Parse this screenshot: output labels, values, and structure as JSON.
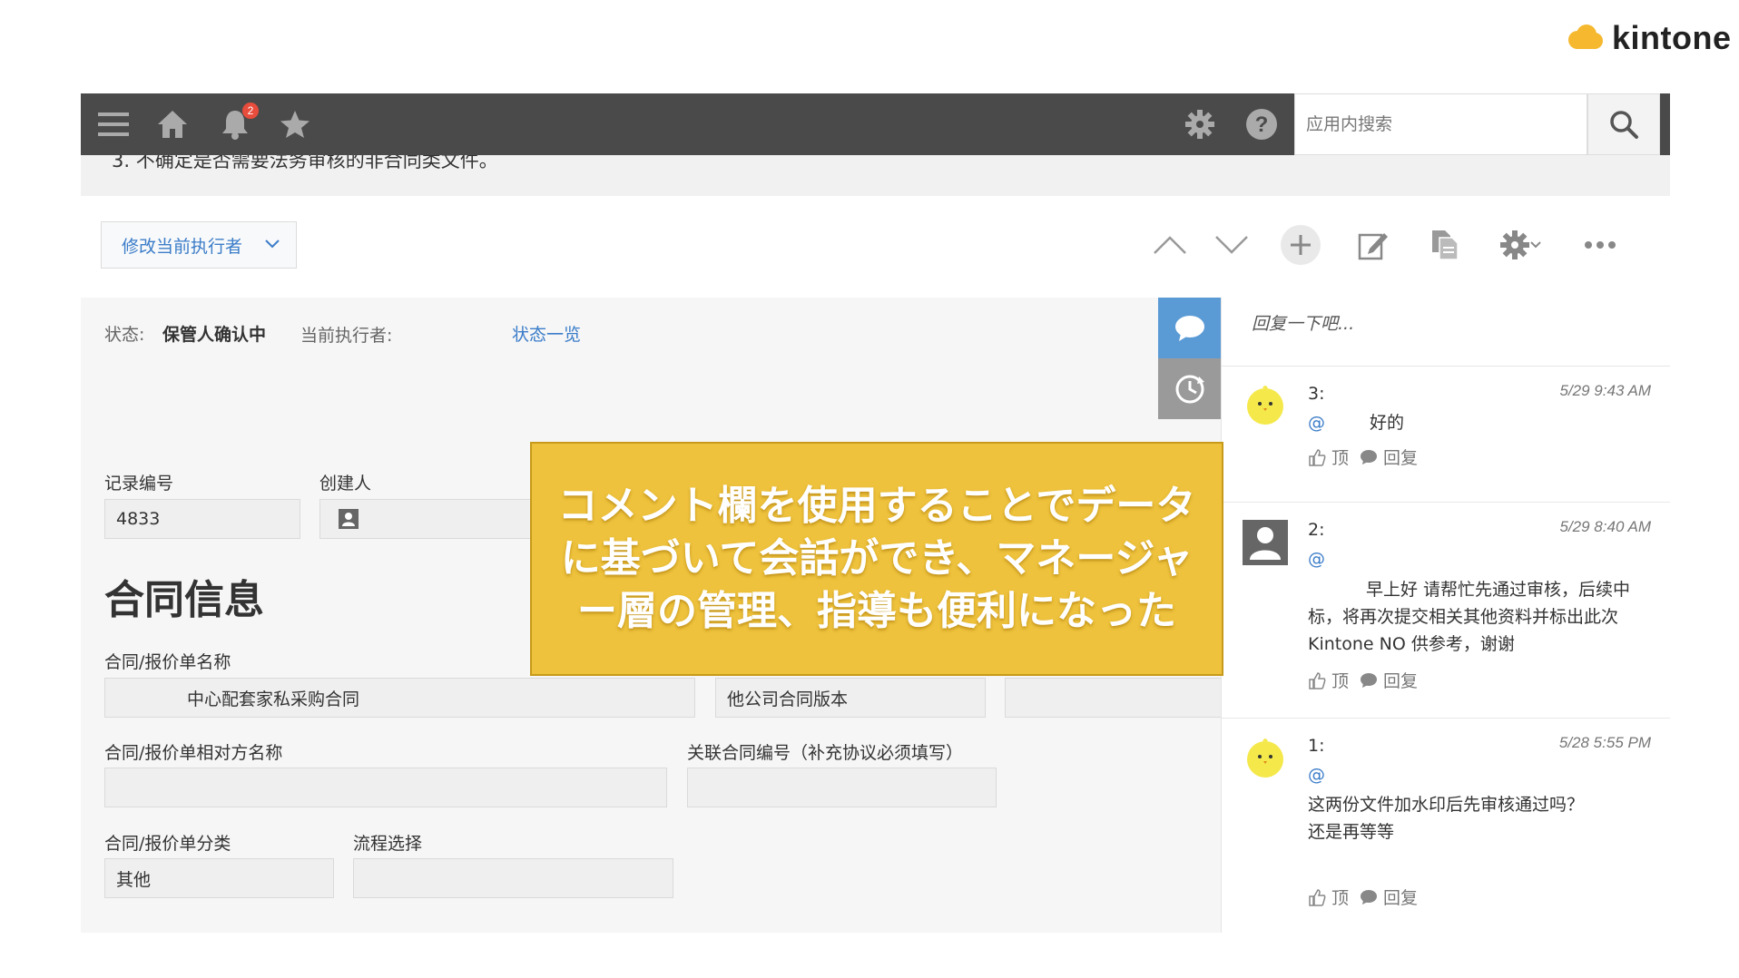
{
  "brand": {
    "name": "kintone"
  },
  "topbar": {
    "notification_count": "2",
    "search_placeholder": "应用内搜索"
  },
  "cut_off_text": "3. 不确定是否需要法务审核的非合同类文件。",
  "actionbar": {
    "assignee_button": "修改当前执行者"
  },
  "status": {
    "status_label": "状态:",
    "status_value": "保管人确认中",
    "assignee_label": "当前执行者:",
    "status_list_link": "状态一览"
  },
  "fields": {
    "record_no_label": "记录编号",
    "record_no_value": "4833",
    "creator_label": "创建人"
  },
  "section": {
    "title": "合同信息",
    "contract_name_label": "合同/报价单名称",
    "contract_name_value": "中心配套家私采购合同",
    "other_company_value": "他公司合同版本",
    "counterparty_label": "合同/报价单相对方名称",
    "related_no_label": "关联合同编号（补充协议必须填写）",
    "category_label": "合同/报价单分类",
    "category_value": "其他",
    "flow_label": "流程选择"
  },
  "comments": {
    "reply_placeholder": "回复一下吧...",
    "like_label": "顶",
    "reply_label": "回复",
    "items": [
      {
        "num": "3:",
        "time": "5/29 9:43 AM",
        "at": "@",
        "body": "好的"
      },
      {
        "num": "2:",
        "time": "5/29 8:40 AM",
        "at": "@",
        "body": "早上好  请帮忙先通过审核，后续中标，将再次提交相关其他资料并标出此次Kintone NO 供参考，谢谢"
      },
      {
        "num": "1:",
        "time": "5/28 5:55 PM",
        "at": "@",
        "body": "这两份文件加水印后先审核通过吗？还是再等等"
      }
    ]
  },
  "overlay": {
    "text": "コメント欄を使用することでデータに基づいて会話ができ、マネージャー層の管理、指導も便利になった"
  },
  "colors": {
    "topbar": "#4a4a4a",
    "link": "#3b7dc9",
    "overlay": "#eec23c",
    "side_tab_active": "#5b9bd5",
    "side_tab_inactive": "#9a9a9a"
  }
}
